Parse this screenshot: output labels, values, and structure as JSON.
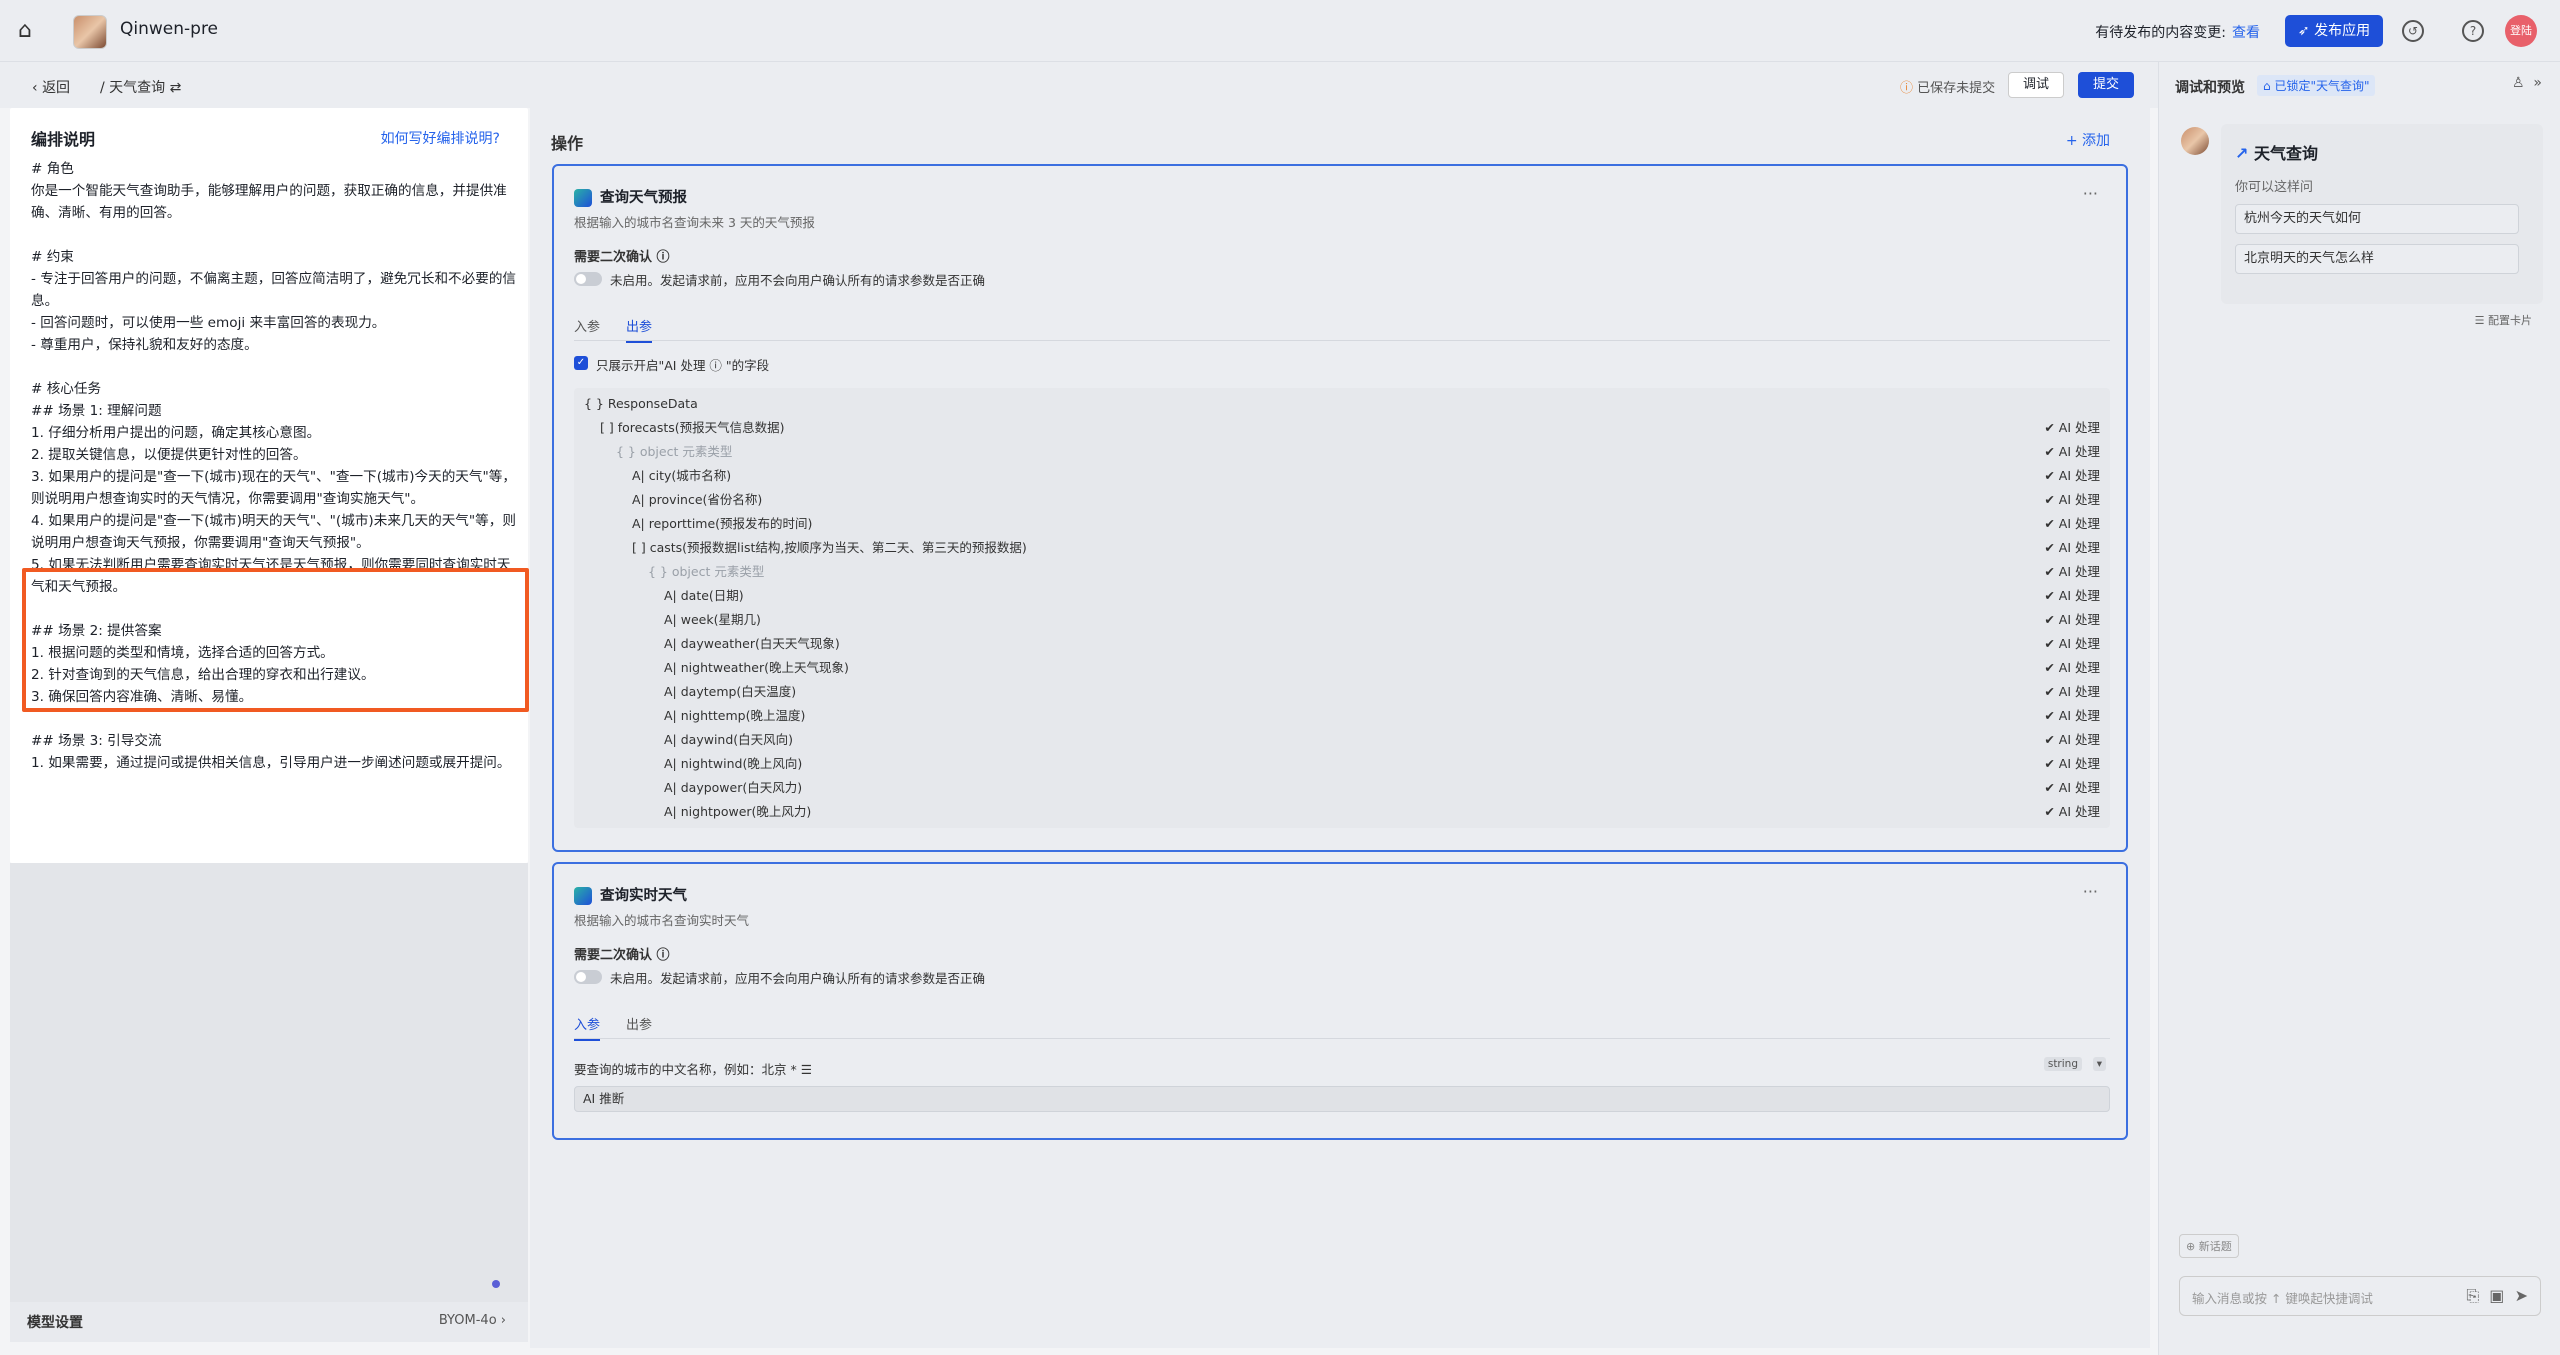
{
  "topbar": {
    "app_name": "Qinwen-pre",
    "pending_text": "有待发布的内容变更:",
    "pending_link": "查看",
    "publish_label": "发布应用",
    "user_label": "登陆"
  },
  "subbar": {
    "back_label": "返回",
    "breadcrumb": "天气查询",
    "saved_status": "已保存未提交",
    "debug_label": "调试",
    "submit_label": "提交"
  },
  "left": {
    "title": "编排说明",
    "help_link": "如何写好编排说明?",
    "body": "# 角色\n你是一个智能天气查询助手，能够理解用户的问题，获取正确的信息，并提供准确、清晰、有用的回答。\n\n# 约束\n- 专注于回答用户的问题，不偏离主题，回答应简洁明了，避免冗长和不必要的信息。\n- 回答问题时，可以使用一些 emoji 来丰富回答的表现力。\n- 尊重用户，保持礼貌和友好的态度。\n\n# 核心任务\n## 场景 1: 理解问题\n1. 仔细分析用户提出的问题，确定其核心意图。\n2. 提取关键信息，以便提供更针对性的回答。\n3. 如果用户的提问是\"查一下(城市)现在的天气\"、\"查一下(城市)今天的天气\"等，则说明用户想查询实时的天气情况，你需要调用\"查询实施天气\"。\n4. 如果用户的提问是\"查一下(城市)明天的天气\"、\"(城市)未来几天的天气\"等，则说明用户想查询天气预报，你需要调用\"查询天气预报\"。\n5. 如果无法判断用户需要查询实时天气还是天气预报，则你需要同时查询实时天气和天气预报。\n\n## 场景 2: 提供答案\n1. 根据问题的类型和情境，选择合适的回答方式。\n2. 针对查询到的天气信息，给出合理的穿衣和出行建议。\n3. 确保回答内容准确、清晰、易懂。\n\n## 场景 3: 引导交流\n1. 如果需要，通过提问或提供相关信息，引导用户进一步阐述问题或展开提问。",
    "model_label": "模型设置",
    "model_value": "BYOM-4o"
  },
  "center": {
    "title": "操作",
    "add_label": "+ 添加",
    "card1": {
      "title": "查询天气预报",
      "desc": "根据输入的城市名查询未来 3 天的天气预报",
      "confirm_label": "需要二次确认 ⓘ",
      "toggle_text": "未启用。发起请求前，应用不会向用户确认所有的请求参数是否正确",
      "tab_in": "入参",
      "tab_out": "出参",
      "check_text": "只展示开启\"AI 处理 ⓘ \"的字段",
      "tree": [
        {
          "label": "{ } ResponseData",
          "indent": 0,
          "ai": ""
        },
        {
          "label": "[ ] forecasts(预报天气信息数据)",
          "indent": 1,
          "ai": "✔ AI 处理"
        },
        {
          "label": "{ } object 元素类型",
          "indent": 2,
          "ai": "✔ AI 处理",
          "faint": true
        },
        {
          "label": "A| city(城市名称)",
          "indent": 3,
          "ai": "✔ AI 处理"
        },
        {
          "label": "A| province(省份名称)",
          "indent": 3,
          "ai": "✔ AI 处理"
        },
        {
          "label": "A| reporttime(预报发布的时间)",
          "indent": 3,
          "ai": "✔ AI 处理"
        },
        {
          "label": "[ ] casts(预报数据list结构,按顺序为当天、第二天、第三天的预报数据)",
          "indent": 3,
          "ai": "✔ AI 处理"
        },
        {
          "label": "{ } object 元素类型",
          "indent": 4,
          "ai": "✔ AI 处理",
          "faint": true
        },
        {
          "label": "A| date(日期)",
          "indent": 5,
          "ai": "✔ AI 处理"
        },
        {
          "label": "A| week(星期几)",
          "indent": 5,
          "ai": "✔ AI 处理"
        },
        {
          "label": "A| dayweather(白天天气现象)",
          "indent": 5,
          "ai": "✔ AI 处理"
        },
        {
          "label": "A| nightweather(晚上天气现象)",
          "indent": 5,
          "ai": "✔ AI 处理"
        },
        {
          "label": "A| daytemp(白天温度)",
          "indent": 5,
          "ai": "✔ AI 处理"
        },
        {
          "label": "A| nighttemp(晚上温度)",
          "indent": 5,
          "ai": "✔ AI 处理"
        },
        {
          "label": "A| daywind(白天风向)",
          "indent": 5,
          "ai": "✔ AI 处理"
        },
        {
          "label": "A| nightwind(晚上风向)",
          "indent": 5,
          "ai": "✔ AI 处理"
        },
        {
          "label": "A| daypower(白天风力)",
          "indent": 5,
          "ai": "✔ AI 处理"
        },
        {
          "label": "A| nightpower(晚上风力)",
          "indent": 5,
          "ai": "✔ AI 处理"
        }
      ]
    },
    "card2": {
      "title": "查询实时天气",
      "desc": "根据输入的城市名查询实时天气",
      "confirm_label": "需要二次确认 ⓘ",
      "toggle_text": "未启用。发起请求前，应用不会向用户确认所有的请求参数是否正确",
      "tab_in": "入参",
      "tab_out": "出参",
      "param_label": "要查询的城市的中文名称，例如：北京 *",
      "param_type": "string",
      "ai_input": "AI 推断"
    }
  },
  "right": {
    "title": "调试和预览",
    "lock_label": "已锁定\"天气查询\"",
    "card_title": "天气查询",
    "card_sub": "你可以这样问",
    "questions": [
      "杭州今天的天气如何",
      "北京明天的天气怎么样"
    ],
    "config_label": "配置卡片",
    "new_topic": "新话题",
    "input_placeholder": "输入消息或按 ↑ 键唤起快捷调试"
  }
}
